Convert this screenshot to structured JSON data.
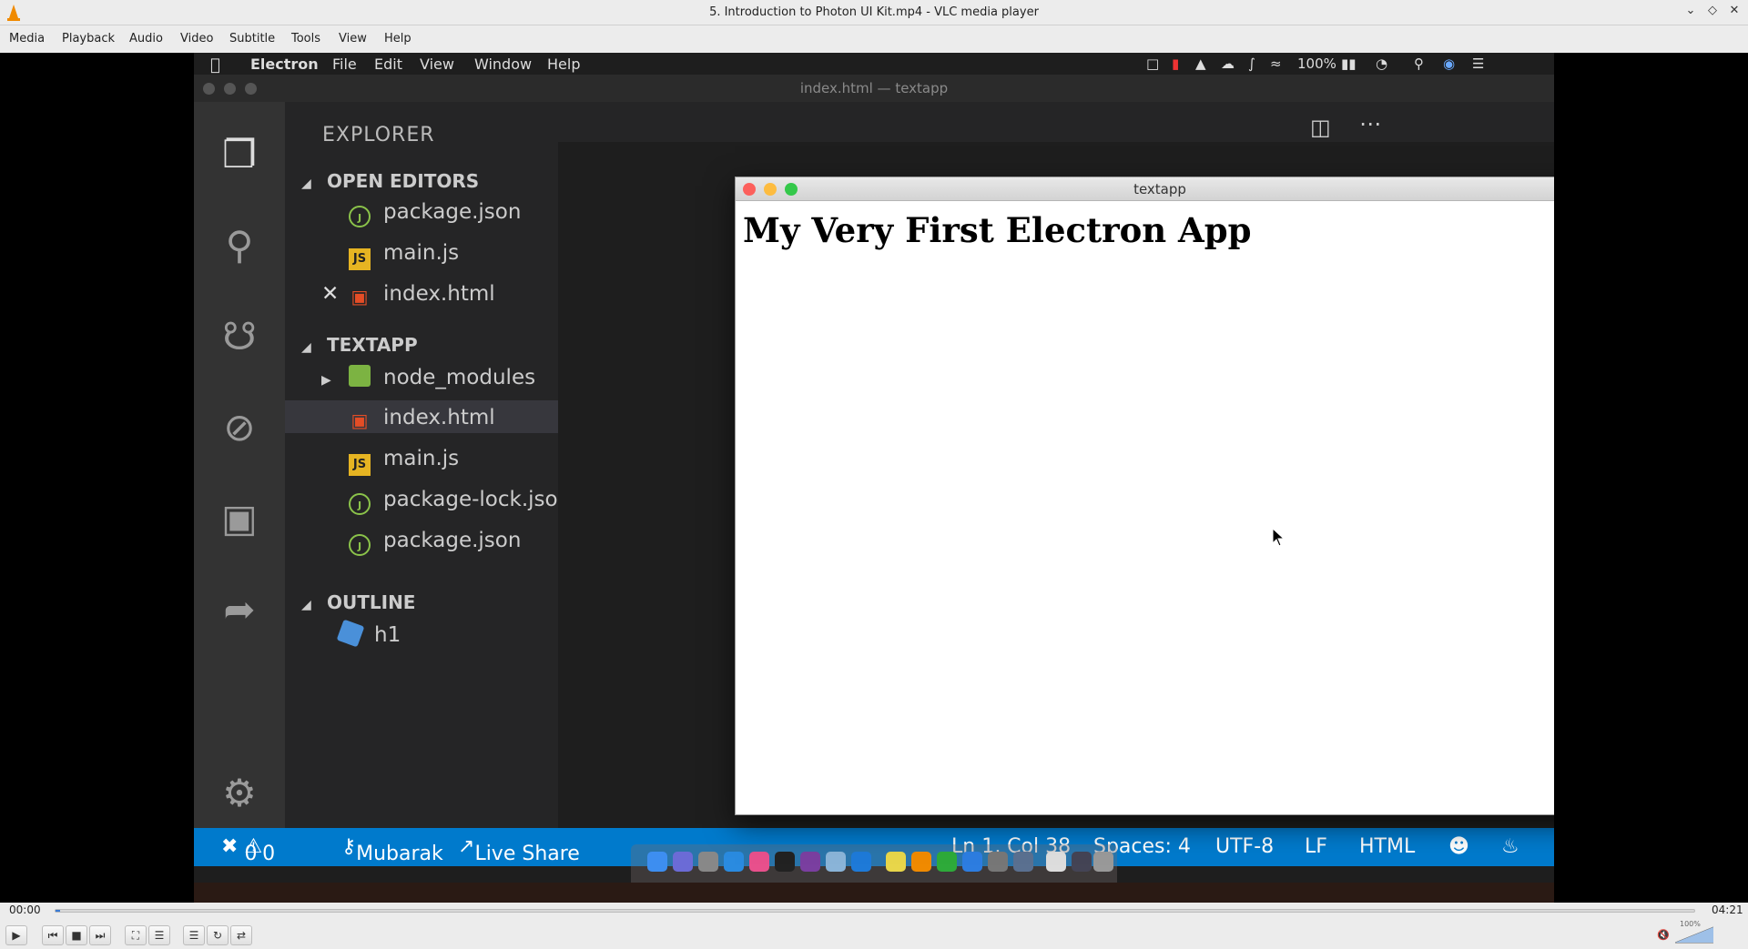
{
  "vlc": {
    "window_title": "5. Introduction to Photon UI Kit.mp4 - VLC media player",
    "menu": [
      "Media",
      "Playback",
      "Audio",
      "Video",
      "Subtitle",
      "Tools",
      "View",
      "Help"
    ],
    "time_elapsed": "00:00",
    "time_total": "04:21",
    "progress": 0.003,
    "volume_label": "100%",
    "volume_level": 1.0
  },
  "mac": {
    "app_name": "Electron",
    "menu": [
      "File",
      "Edit",
      "View",
      "Window",
      "Help"
    ],
    "battery": "100%"
  },
  "vscode": {
    "window_title": "index.html — textapp",
    "explorer_title": "EXPLORER",
    "open_editors_title": "OPEN EDITORS",
    "open_editors": [
      {
        "name": "package.json",
        "icon": "json-file-icon"
      },
      {
        "name": "main.js",
        "icon": "js-file-icon"
      },
      {
        "name": "index.html",
        "icon": "html-file-icon"
      }
    ],
    "project_title": "TEXTAPP",
    "project_files": [
      {
        "name": "node_modules",
        "icon": "folder-icon"
      },
      {
        "name": "index.html",
        "icon": "html-file-icon"
      },
      {
        "name": "main.js",
        "icon": "js-file-icon"
      },
      {
        "name": "package-lock.json",
        "icon": "json-file-icon"
      },
      {
        "name": "package.json",
        "icon": "json-file-icon"
      }
    ],
    "outline_title": "OUTLINE",
    "outline_items": [
      {
        "name": "h1",
        "icon": "element-icon"
      }
    ],
    "status": {
      "errors": "0",
      "warnings": "0",
      "branch": "Mubarak",
      "live_share": "Live Share",
      "position": "Ln 1, Col 38",
      "spaces": "Spaces: 4",
      "encoding": "UTF-8",
      "eol": "LF",
      "language": "HTML"
    },
    "status_bar_color": "#007acc"
  },
  "electron_window": {
    "title": "textapp",
    "heading": "My Very First Electron App"
  }
}
